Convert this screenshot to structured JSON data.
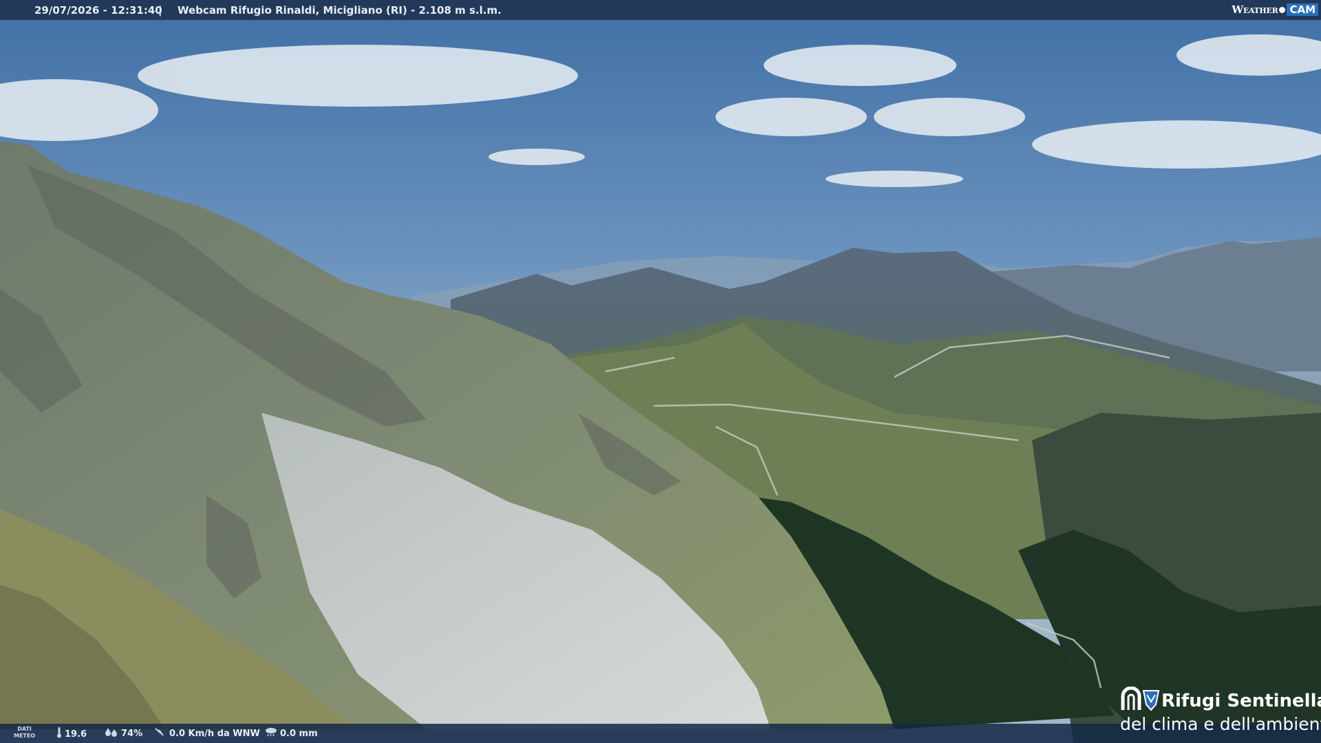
{
  "header": {
    "timestamp": "29/07/2026 - 12:31:40",
    "separator": "|",
    "title": "Webcam Rifugio Rinaldi, Micigliano (RI) - 2.108 m s.l.m.",
    "brand_weather": "Weather",
    "brand_cam": "CAM"
  },
  "weather": {
    "label_line1": "DATI",
    "label_line2": "METEO",
    "temperature": "19.6",
    "humidity": "74%",
    "wind": "0.0 Km/h da WNW",
    "rain": "0.0 mm",
    "icons": [
      "thermometer-icon",
      "humidity-icon",
      "wind-icon",
      "rain-icon"
    ]
  },
  "logo": {
    "line1": "Rifugi Sentinella",
    "line2": "del clima e dell'ambiente"
  },
  "colors": {
    "bar": "#1c2d48",
    "logo_blue": "#2b6fb8"
  }
}
